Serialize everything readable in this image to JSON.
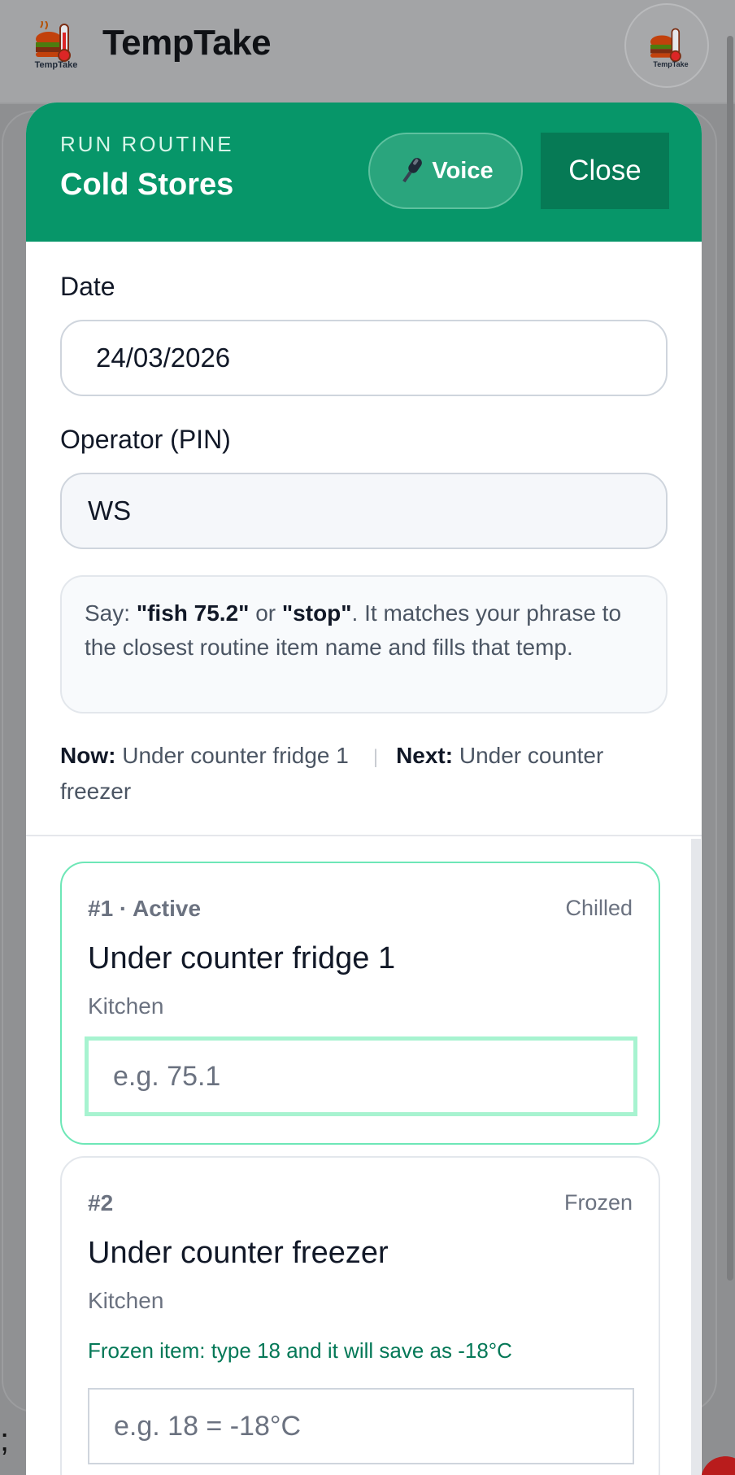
{
  "app": {
    "title": "TempTake",
    "logo_caption": "TempTake"
  },
  "background": {
    "stray_text": ";"
  },
  "modal": {
    "kicker": "RUN ROUTINE",
    "title": "Cold Stores",
    "voice_label": "Voice",
    "close_label": "Close",
    "date_label": "Date",
    "date_value": "24/03/2026",
    "operator_label": "Operator (PIN)",
    "operator_value": "WS",
    "hint": {
      "say": "Say: ",
      "example1": "\"fish 75.2\"",
      "or": " or ",
      "example2": "\"stop\"",
      "rest": ". It matches your phrase to the closest routine item name and fills that temp."
    },
    "now_label": "Now:",
    "now_value": "Under counter fridge 1",
    "separator": "|",
    "next_label": "Next:",
    "next_value": "Under counter freezer"
  },
  "items": [
    {
      "num": "#1 · Active",
      "category": "Chilled",
      "name": "Under counter fridge 1",
      "location": "Kitchen",
      "placeholder": "e.g. 75.1"
    },
    {
      "num": "#2",
      "category": "Frozen",
      "name": "Under counter freezer",
      "location": "Kitchen",
      "note": "Frozen item: type 18 and it will save as -18°C",
      "placeholder": "e.g. 18 = -18°C"
    }
  ],
  "colors": {
    "brand_green": "#079669",
    "close_button": "#067a55",
    "active_border": "#6ee7b7",
    "frozen_note": "#047857"
  },
  "icons": {
    "voice": "microphone-icon",
    "logo": "thermometer-burger-logo"
  }
}
